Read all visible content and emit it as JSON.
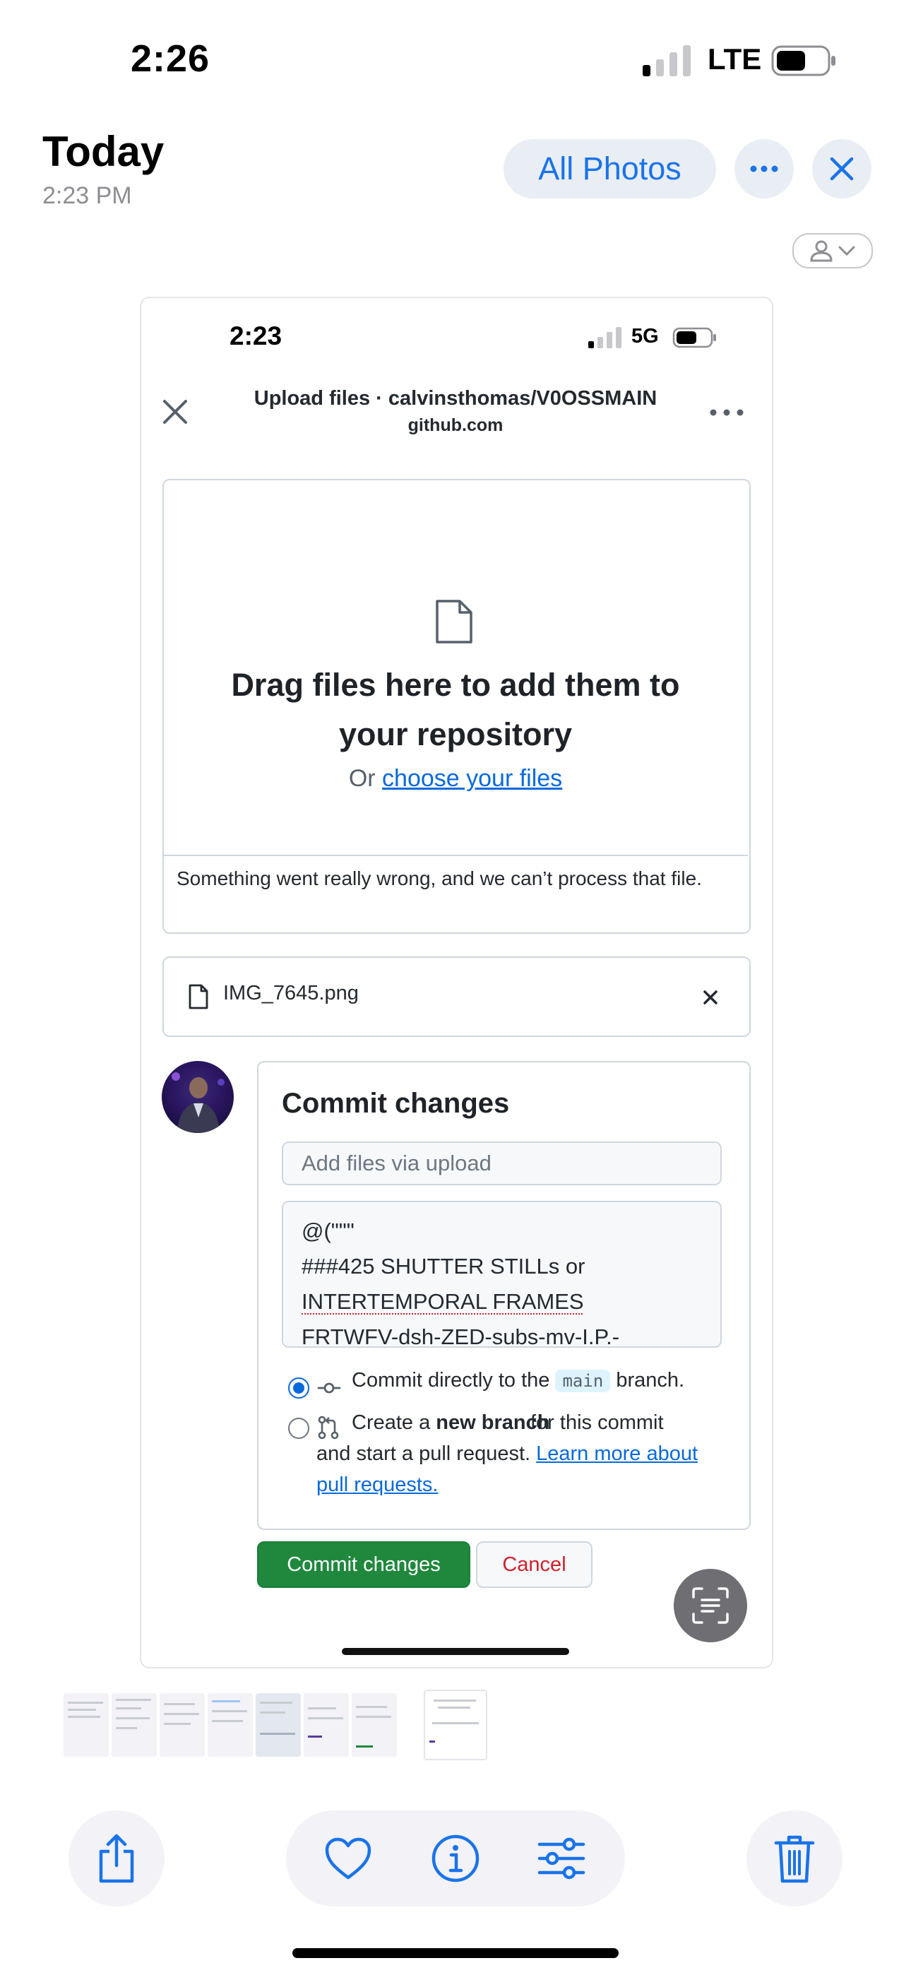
{
  "status_bar": {
    "time": "2:26",
    "carrier": "LTE"
  },
  "photos_header": {
    "title": "Today",
    "subtitle": "2:23 PM",
    "all_photos_label": "All Photos"
  },
  "screenshot": {
    "status_bar": {
      "time": "2:23",
      "network": "5G"
    },
    "browser": {
      "title": "Upload files · calvinsthomas/V0OSSMAIN",
      "host": "github.com"
    },
    "upload": {
      "heading_line1": "Drag files here to add them to",
      "heading_line2": "your repository",
      "or_text": "Or",
      "choose_link": "choose your files",
      "error_text": "Something went really wrong, and we can’t process that file."
    },
    "file": {
      "name": "IMG_7645.png"
    },
    "commit": {
      "heading": "Commit changes",
      "summary_placeholder": "Add files via upload",
      "description_lines": [
        "@(\"\"\"",
        "###425 SHUTTER STILLs or",
        "INTERTEMPORAL FRAMES",
        "FRTWFV-dsh-ZED-subs-mv-I.P.-"
      ],
      "option_direct_pre": "Commit directly to the",
      "option_direct_branch": "main",
      "option_direct_post": "branch.",
      "option_new_pre": "Create a",
      "option_new_bold": "new branch",
      "option_new_mid": "for this commit and start a pull request.",
      "option_new_link": "Learn more about pull requests.",
      "selected_option": "direct"
    },
    "buttons": {
      "commit": "Commit changes",
      "cancel": "Cancel"
    }
  },
  "toolbar": {
    "icons": [
      "share-icon",
      "heart-icon",
      "info-icon",
      "adjust-icon",
      "trash-icon"
    ]
  },
  "colors": {
    "ios_blue": "#1a73e8",
    "github_green": "#1f883d",
    "github_link": "#0969da",
    "cancel_red": "#cf222e"
  }
}
